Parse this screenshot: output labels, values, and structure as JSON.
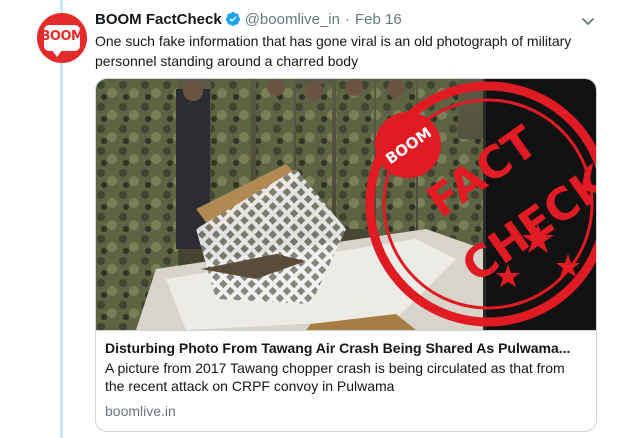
{
  "tweet": {
    "display_name": "BOOM FactCheck",
    "handle": "@boomlive_in",
    "separator": "·",
    "date": "Feb 16",
    "avatar_text": "BOOM",
    "text": "One such fake information that has gone viral is an old photograph of military personnel standing around a charred body"
  },
  "card": {
    "title": "Disturbing Photo From Tawang Air Crash Being Shared As Pulwama...",
    "description": "A picture from 2017 Tawang chopper crash is being circulated as that from the recent attack on CRPF convoy in Pulwama",
    "domain": "boomlive.in",
    "stamp_brand": "BOOM",
    "stamp_line1": "FACT",
    "stamp_line2": "CHECK"
  },
  "icons": {
    "verified": "verified-badge-icon",
    "more": "chevron-down-icon"
  },
  "colors": {
    "brand_red": "#e52a2a",
    "link_blue": "#1da1f2",
    "muted": "#657786",
    "thread": "#cbe3f5"
  }
}
